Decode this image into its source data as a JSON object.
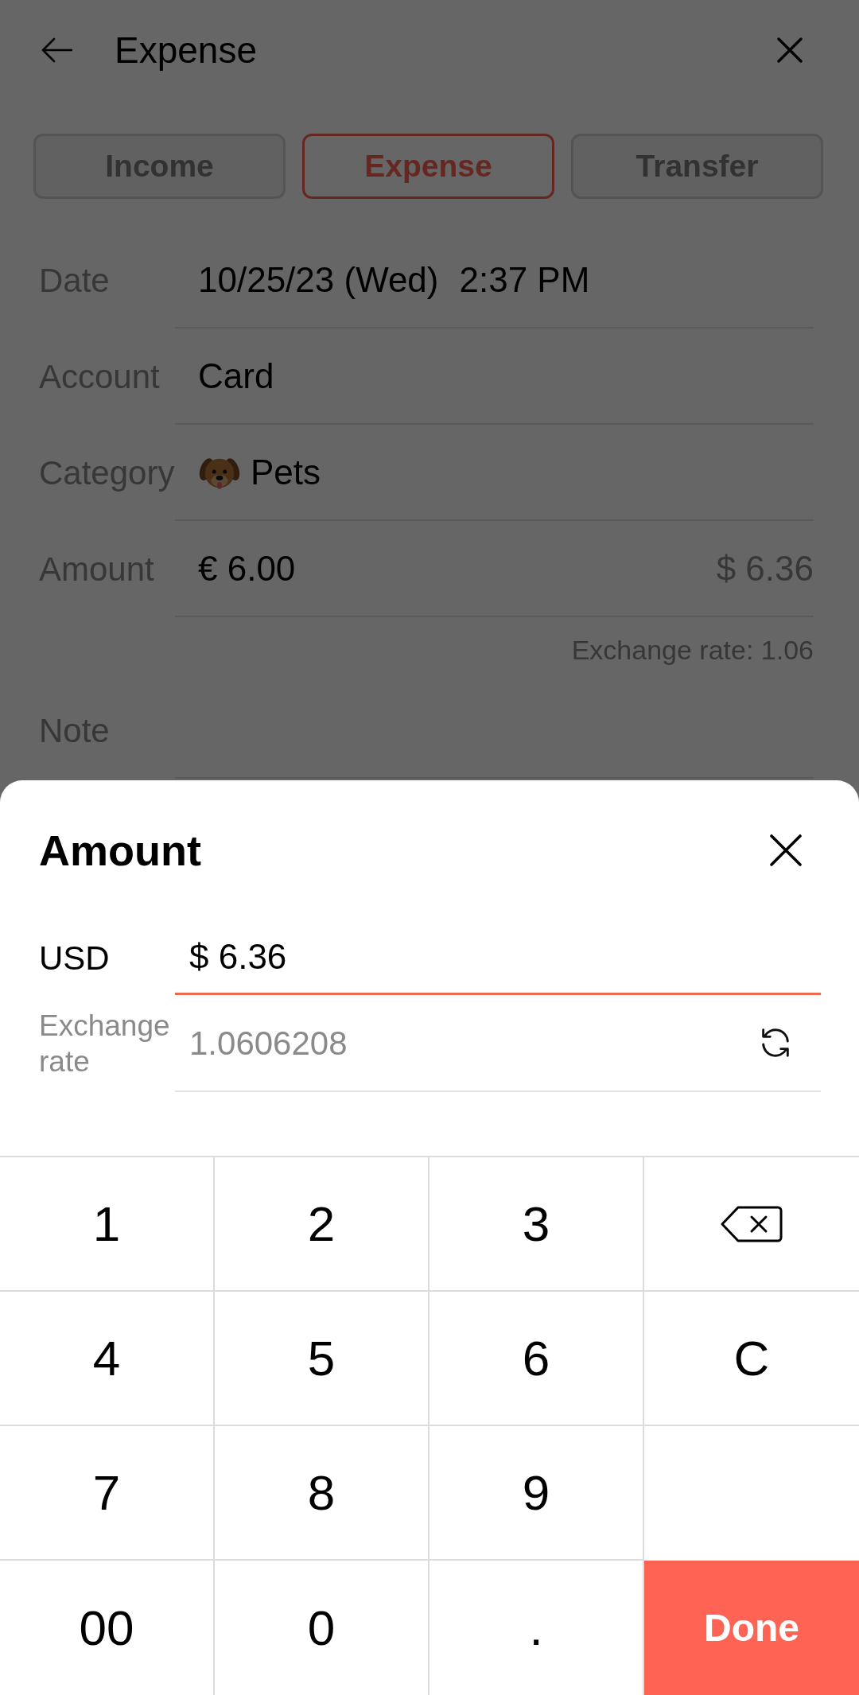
{
  "header": {
    "title": "Expense"
  },
  "tabs": [
    {
      "label": "Income",
      "selected": false
    },
    {
      "label": "Expense",
      "selected": true
    },
    {
      "label": "Transfer",
      "selected": false
    }
  ],
  "fields": [
    {
      "kind": "datetime",
      "label": "Date",
      "date": "10/25/23 (Wed)",
      "time": "2:37 PM"
    },
    {
      "kind": "text",
      "label": "Account",
      "value": "Card"
    },
    {
      "kind": "category",
      "label": "Category",
      "value": "Pets"
    },
    {
      "kind": "amount",
      "label": "Amount",
      "value": "€ 6.00",
      "converted": "$ 6.36",
      "rate_note": "Exchange rate: 1.06"
    },
    {
      "kind": "text",
      "label": "Note"
    }
  ],
  "amount_sheet": {
    "title": "Amount",
    "fields": [
      {
        "kind": "input",
        "label": "USD",
        "value": "$ 6.36",
        "focused": true
      },
      {
        "kind": "rate",
        "label": "Exchange rate",
        "value": "1.0606208",
        "focused": false
      }
    ]
  },
  "keypad": [
    {
      "kind": "digit",
      "label": "1"
    },
    {
      "kind": "digit",
      "label": "2"
    },
    {
      "kind": "digit",
      "label": "3"
    },
    {
      "kind": "backspace"
    },
    {
      "kind": "digit",
      "label": "4"
    },
    {
      "kind": "digit",
      "label": "5"
    },
    {
      "kind": "digit",
      "label": "6"
    },
    {
      "kind": "clear",
      "label": "C"
    },
    {
      "kind": "digit",
      "label": "7"
    },
    {
      "kind": "digit",
      "label": "8"
    },
    {
      "kind": "digit",
      "label": "9"
    },
    {
      "kind": "blank"
    },
    {
      "kind": "digit",
      "label": "00"
    },
    {
      "kind": "digit",
      "label": "0"
    },
    {
      "kind": "decimal",
      "label": "."
    },
    {
      "kind": "done",
      "label": "Done"
    }
  ]
}
